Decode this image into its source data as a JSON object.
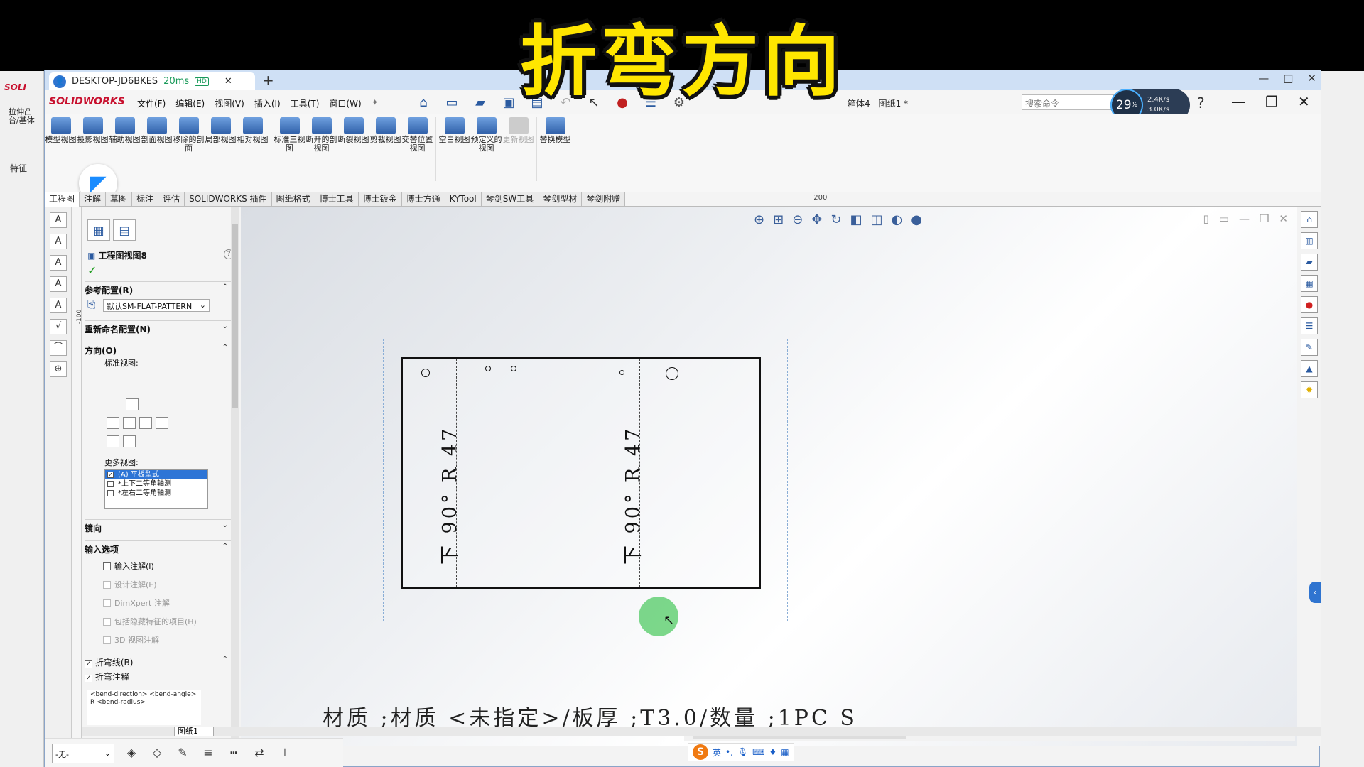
{
  "overlay": {
    "caption": "折弯方向"
  },
  "outer": {
    "left_logo": "SOLI",
    "left_btn": "拉伸凸台/基体",
    "left_tab": "特征"
  },
  "rd": {
    "tab_title": "DESKTOP-JD6BKES",
    "ping": "20ms",
    "hd": "HD",
    "avatar": "👤",
    "plus": "+",
    "close_tab": "✕",
    "win_min": "—",
    "win_max": "□",
    "win_close": "✕"
  },
  "sw": {
    "logo": "SOLIDWORKS",
    "menu": [
      "文件(F)",
      "编辑(E)",
      "视图(V)",
      "插入(I)",
      "工具(T)",
      "窗口(W)"
    ],
    "pin": "✦",
    "doc_title": "箱体4 - 图纸1 *",
    "search_placeholder": "搜索命令",
    "net_pct": "29",
    "net_unit": "%",
    "up_speed": "2.4K/s",
    "down_speed": "3.0K/s",
    "help": "?",
    "min": "—",
    "restore": "❐",
    "close": "✕"
  },
  "ribbon": {
    "buttons": [
      {
        "label": "模型视图",
        "disabled": false
      },
      {
        "label": "投影视图",
        "disabled": false
      },
      {
        "label": "辅助视图",
        "disabled": false
      },
      {
        "label": "剖面视图",
        "disabled": false
      },
      {
        "label": "移除的剖面",
        "disabled": false
      },
      {
        "label": "局部视图",
        "disabled": false
      },
      {
        "label": "相对视图",
        "disabled": false
      },
      {
        "label": "标准三视图",
        "disabled": false
      },
      {
        "label": "断开的剖视图",
        "disabled": false
      },
      {
        "label": "断裂视图",
        "disabled": false
      },
      {
        "label": "剪裁视图",
        "disabled": false
      },
      {
        "label": "交替位置视图",
        "disabled": false
      },
      {
        "label": "空白视图",
        "disabled": false
      },
      {
        "label": "预定义的视图",
        "disabled": false
      },
      {
        "label": "更新视图",
        "disabled": true
      },
      {
        "label": "替换模型",
        "disabled": false
      }
    ]
  },
  "cm_tabs": [
    "工程图",
    "注解",
    "草图",
    "标注",
    "评估",
    "SOLIDWORKS 插件",
    "图纸格式",
    "博士工具",
    "博士钣金",
    "博士方通",
    "KYTool",
    "琴剑SW工具",
    "琴剑型材",
    "琴剑附赠"
  ],
  "ruler": {
    "mark": "200",
    "vmark": "-100"
  },
  "pm": {
    "title": "工程图视图8",
    "help": "?",
    "check": "✓",
    "ref_config_label": "参考配置(R)",
    "ref_config_value": "默认SM-FLAT-PATTERN",
    "rename_config_label": "重新命名配置(N)",
    "orientation_label": "方向(O)",
    "standard_views_label": "标准视图:",
    "more_views_label": "更多视图:",
    "more_views": [
      {
        "label": "(A) 平板型式",
        "checked": true,
        "selected": true
      },
      {
        "label": "*上下二等角轴测",
        "checked": false,
        "selected": false
      },
      {
        "label": "*左右二等角轴测",
        "checked": false,
        "selected": false
      }
    ],
    "mirror_label": "镜向",
    "import_options_label": "输入选项",
    "import_options": [
      {
        "label": "输入注解(I)",
        "disabled": false
      },
      {
        "label": "设计注解(E)",
        "disabled": true
      },
      {
        "label": "DimXpert 注解",
        "disabled": true
      },
      {
        "label": "包括隐藏特征的项目(H)",
        "disabled": true
      },
      {
        "label": "3D 视图注解",
        "disabled": true
      }
    ],
    "bend_lines_label": "折弯线(B)",
    "bend_notes_label": "折弯注释",
    "bend_note_template": "<bend-direction> <bend-angle> R <bend-radius>",
    "chev_up": "⌃",
    "chev_down": "⌄"
  },
  "drawing": {
    "bend_left": "下 90° R 47",
    "bend_right": "下 90° R 47",
    "material_note": "材质 ;材质 <未指定>/板厚 ;T3.0/数量 ;1PC S"
  },
  "bottom": {
    "sheet_tab": "图纸1",
    "layer": "-无-",
    "ime_lang": "英"
  }
}
